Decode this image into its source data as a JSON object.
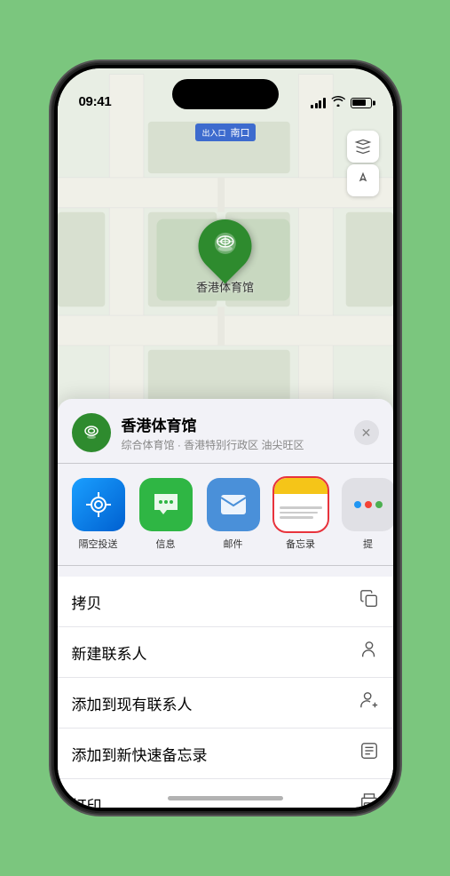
{
  "status_bar": {
    "time": "09:41",
    "location_arrow": "▲"
  },
  "map": {
    "label": "南口",
    "label_prefix": "出入口",
    "marker_label": "香港体育馆"
  },
  "map_controls": {
    "layers_icon": "🗺",
    "location_icon": "⬆"
  },
  "sheet": {
    "venue_name": "香港体育馆",
    "venue_desc": "综合体育馆 · 香港特别行政区 油尖旺区",
    "close_label": "✕"
  },
  "share_items": [
    {
      "id": "airdrop",
      "label": "隔空投送",
      "type": "airdrop"
    },
    {
      "id": "message",
      "label": "信息",
      "type": "message"
    },
    {
      "id": "mail",
      "label": "邮件",
      "type": "mail"
    },
    {
      "id": "notes",
      "label": "备忘录",
      "type": "notes"
    },
    {
      "id": "more",
      "label": "提",
      "type": "more"
    }
  ],
  "menu_items": [
    {
      "label": "拷贝",
      "icon": "copy"
    },
    {
      "label": "新建联系人",
      "icon": "person"
    },
    {
      "label": "添加到现有联系人",
      "icon": "person-add"
    },
    {
      "label": "添加到新快速备忘录",
      "icon": "note"
    },
    {
      "label": "打印",
      "icon": "printer"
    }
  ]
}
